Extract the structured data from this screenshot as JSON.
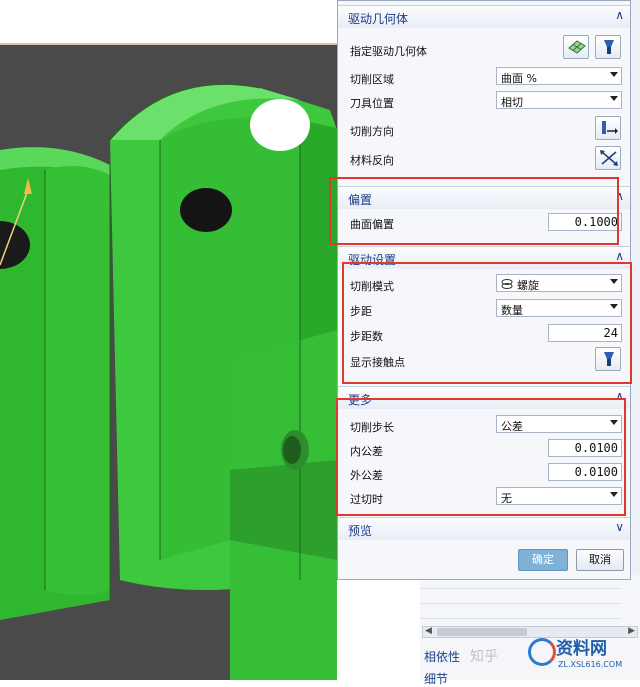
{
  "panel": {
    "sections": {
      "drive_geometry": {
        "title": "驱动几何体",
        "specify_label": "指定驱动几何体"
      },
      "offset": {
        "title": "偏置",
        "surface_offset_label": "曲面偏置",
        "surface_offset_value": "0.1000"
      },
      "drive_settings": {
        "title": "驱动设置"
      },
      "more": {
        "title": "更多"
      },
      "preview": {
        "title": "预览"
      }
    },
    "cut_region": {
      "label": "切削区域",
      "value": "曲面 %"
    },
    "tool_position": {
      "label": "刀具位置",
      "value": "相切"
    },
    "cut_direction": {
      "label": "切削方向"
    },
    "material_reverse": {
      "label": "材料反向"
    },
    "cut_pattern": {
      "label": "切削模式",
      "value": "螺旋"
    },
    "stepover": {
      "label": "步距",
      "value": "数量"
    },
    "step_count": {
      "label": "步距数",
      "value": "24"
    },
    "show_contact": {
      "label": "显示接触点"
    },
    "cut_step": {
      "label": "切削步长",
      "value": "公差"
    },
    "inner_tol": {
      "label": "内公差",
      "value": "0.0100"
    },
    "outer_tol": {
      "label": "外公差",
      "value": "0.0100"
    },
    "overcut": {
      "label": "过切时",
      "value": "无"
    },
    "ok_label": "确定",
    "cancel_label": "取消"
  },
  "side": {
    "dependency_tab": "相依性",
    "detail_tab": "细节"
  },
  "watermark": {
    "zhihu": "知乎",
    "logo_title": "资料网",
    "logo_url": "ZL.XSL616.COM"
  },
  "icons": {
    "geometry": "mesh-surface-icon",
    "flashlight": "flashlight-icon",
    "direction": "cut-direction-icon",
    "reverse": "reverse-arrows-icon",
    "spiral": "spiral-icon"
  },
  "colors": {
    "model_green": "#3ec83e",
    "highlight_red": "#e0382e",
    "section_title": "#1b3c88"
  }
}
